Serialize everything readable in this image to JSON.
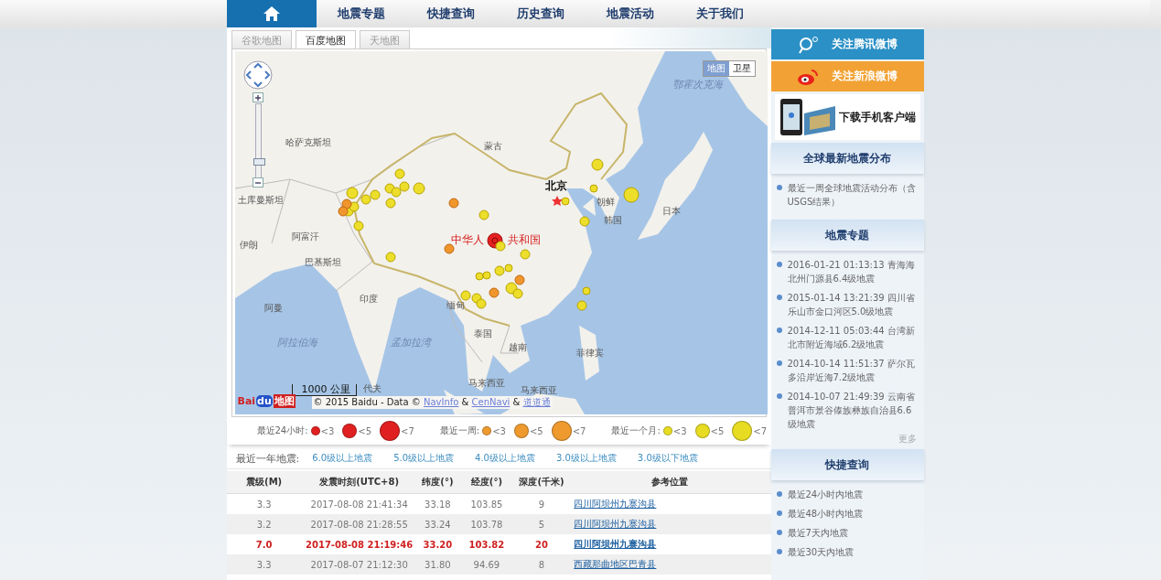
{
  "nav": {
    "items": [
      {
        "kind": "home"
      },
      {
        "kind": "text",
        "label": "地震专题"
      },
      {
        "kind": "text",
        "label": "快捷查询"
      },
      {
        "kind": "text",
        "label": "历史查询"
      },
      {
        "kind": "text",
        "label": "地震活动"
      },
      {
        "kind": "text",
        "label": "关于我们"
      }
    ]
  },
  "map_tabs": [
    {
      "label": "谷歌地图",
      "selected": false
    },
    {
      "label": "百度地图",
      "selected": true
    },
    {
      "label": "天地图",
      "selected": false
    }
  ],
  "map": {
    "type_toggle": [
      {
        "label": "地图",
        "selected": true
      },
      {
        "label": "卫星",
        "selected": false
      }
    ],
    "zoom": {
      "level": 0.2
    },
    "labels": [
      {
        "text": "鄂霍次克海",
        "kind": "sea"
      },
      {
        "text": "哈萨克斯坦",
        "kind": "country"
      },
      {
        "text": "蒙古",
        "kind": "country"
      },
      {
        "text": "北京",
        "kind": "capital"
      },
      {
        "text": "朝鲜",
        "kind": "country"
      },
      {
        "text": "日本",
        "kind": "country"
      },
      {
        "text": "韩国",
        "kind": "country"
      },
      {
        "text": "土库曼斯坦",
        "kind": "country"
      },
      {
        "text": "伊朗",
        "kind": "country"
      },
      {
        "text": "阿富汗",
        "kind": "country"
      },
      {
        "text": "中华人",
        "kind": "home"
      },
      {
        "text": "共和国",
        "kind": "home"
      },
      {
        "text": "巴基斯坦",
        "kind": "country"
      },
      {
        "text": "印度",
        "kind": "country"
      },
      {
        "text": "阿曼",
        "kind": "country"
      },
      {
        "text": "缅甸",
        "kind": "country"
      },
      {
        "text": "泰国",
        "kind": "country"
      },
      {
        "text": "阿拉伯海",
        "kind": "sea"
      },
      {
        "text": "孟加拉湾",
        "kind": "sea"
      },
      {
        "text": "越南",
        "kind": "country"
      },
      {
        "text": "菲律宾",
        "kind": "country"
      },
      {
        "text": "马来西亚",
        "kind": "country"
      },
      {
        "text": "马来西亚",
        "kind": "country"
      },
      {
        "text": "代夫",
        "kind": "country"
      }
    ],
    "scale": "1000 公里",
    "logo": [
      "Bai",
      "du",
      "地图"
    ],
    "attribution": "© 2015 Baidu - Data © ",
    "attribution_links": [
      "NavInfo",
      "&",
      "CenNavi",
      "&",
      "道道通"
    ]
  },
  "legend": [
    {
      "label": "最近24小时:",
      "color": "#e02020",
      "items": [
        "<3",
        "<5",
        "<7"
      ]
    },
    {
      "label": "最近一周:",
      "color": "#ee9a2e",
      "items": [
        "<3",
        "<5",
        "<7"
      ]
    },
    {
      "label": "最近一个月:",
      "color": "#e8dc22",
      "items": [
        "<3",
        "<5",
        "<7"
      ]
    }
  ],
  "year_links": {
    "label": "最近一年地震:",
    "links": [
      "6.0级以上地震",
      "5.0级以上地震",
      "4.0级以上地震",
      "3.0级以上地震",
      "3.0级以下地震"
    ]
  },
  "table": {
    "columns": [
      "震级(M)",
      "发震时刻(UTC+8)",
      "纬度(°)",
      "经度(°)",
      "深度(千米)",
      "参考位置"
    ],
    "rows": [
      {
        "highlighted": false,
        "cells": [
          "3.3",
          "2017-08-08 21:41:34",
          "33.18",
          "103.85",
          "9",
          "四川阿坝州九寨沟县"
        ]
      },
      {
        "highlighted": false,
        "cells": [
          "3.2",
          "2017-08-08 21:28:55",
          "33.24",
          "103.78",
          "5",
          "四川阿坝州九寨沟县"
        ]
      },
      {
        "highlighted": true,
        "cells": [
          "7.0",
          "2017-08-08 21:19:46",
          "33.20",
          "103.82",
          "20",
          "四川阿坝州九寨沟县"
        ]
      },
      {
        "highlighted": false,
        "cells": [
          "3.3",
          "2017-08-07 21:12:30",
          "31.80",
          "94.69",
          "8",
          "西藏那曲地区巴青县"
        ]
      }
    ]
  },
  "sidebar": {
    "follow_buttons": [
      {
        "kind": "tencent",
        "label": "关注腾讯微博"
      },
      {
        "kind": "sina",
        "label": "关注新浪微博"
      }
    ],
    "app_banner": "下载手机客户端",
    "sections": [
      {
        "title": "全球最新地震分布",
        "items": [
          "最近一周全球地震活动分布（含USGS结果）"
        ]
      },
      {
        "title": "地震专题",
        "items": [
          "2016-01-21 01:13:13 青海海北州门源县6.4级地震",
          "2015-01-14 13:21:39 四川省乐山市金口河区5.0级地震",
          "2014-12-11 05:03:44 台湾新北市附近海域6.2级地震",
          "2014-10-14 11:51:37 萨尔瓦多沿岸近海7.2级地震",
          "2014-10-07 21:49:39 云南省普洱市景谷傣族彝族自治县6.6级地震"
        ],
        "more": "更多"
      },
      {
        "title": "快捷查询",
        "items": [
          "最近24小时内地震",
          "最近48小时内地震",
          "最近7天内地震",
          "最近30天内地震"
        ]
      }
    ]
  }
}
